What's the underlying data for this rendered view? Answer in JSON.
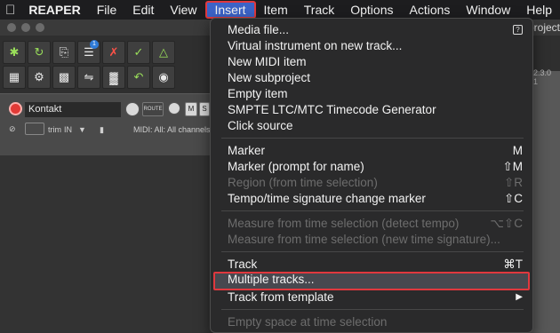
{
  "menubar": {
    "apple_icon": "apple-icon",
    "items": [
      "REAPER",
      "File",
      "Edit",
      "View",
      "Insert",
      "Item",
      "Track",
      "Options",
      "Actions",
      "Window",
      "Help"
    ],
    "active": "Insert"
  },
  "window": {
    "project_label": "project"
  },
  "track": {
    "name": "Kontakt",
    "route_label": "ROUTE",
    "mute_label": "M",
    "solo_label": "S",
    "trim_label": "trim",
    "in_label": "IN",
    "midi_label": "MIDI: All: All channels",
    "ruler_top": "2.3.0",
    "ruler_bottom": "1"
  },
  "insert_menu": {
    "items": [
      {
        "label": "Media file...",
        "shortcut": "?",
        "enabled": true
      },
      {
        "label": "Virtual instrument on new track...",
        "shortcut": "",
        "enabled": true
      },
      {
        "label": "New MIDI item",
        "shortcut": "",
        "enabled": true
      },
      {
        "label": "New subproject",
        "shortcut": "",
        "enabled": true
      },
      {
        "label": "Empty item",
        "shortcut": "",
        "enabled": true
      },
      {
        "label": "SMPTE LTC/MTC Timecode Generator",
        "shortcut": "",
        "enabled": true
      },
      {
        "label": "Click source",
        "shortcut": "",
        "enabled": true
      },
      {
        "label": "Marker",
        "shortcut": "M",
        "enabled": true
      },
      {
        "label": "Marker (prompt for name)",
        "shortcut": "⇧M",
        "enabled": true
      },
      {
        "label": "Region (from time selection)",
        "shortcut": "⇧R",
        "enabled": false
      },
      {
        "label": "Tempo/time signature change marker",
        "shortcut": "⇧C",
        "enabled": true
      },
      {
        "label": "Measure from time selection (detect tempo)",
        "shortcut": "⌥⇧C",
        "enabled": false
      },
      {
        "label": "Measure from time selection (new time signature)...",
        "shortcut": "",
        "enabled": false
      },
      {
        "label": "Track",
        "shortcut": "⌘T",
        "enabled": true
      },
      {
        "label": "Multiple tracks...",
        "shortcut": "",
        "enabled": true,
        "highlighted": true
      },
      {
        "label": "Track from template",
        "shortcut": "▶",
        "enabled": true
      },
      {
        "label": "Empty space at time selection",
        "shortcut": "",
        "enabled": false
      }
    ]
  }
}
